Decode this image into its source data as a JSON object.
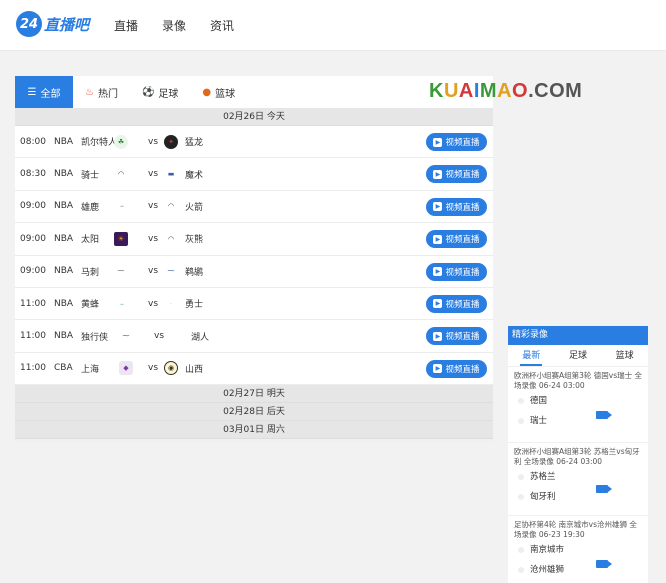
{
  "header": {
    "logo_number": "24",
    "logo_text": "直播吧",
    "nav": [
      "直播",
      "录像",
      "资讯"
    ]
  },
  "tabs": {
    "all": "全部",
    "hot": "热门",
    "football": "足球",
    "basketball": "篮球"
  },
  "brand_text": "KUAIMAO.COM",
  "dates": {
    "today": "02月26日 今天",
    "tomorrow": "02月27日 明天",
    "day_after": "02月28日 后天",
    "march1": "03月01日 周六"
  },
  "live_label": "视频直播",
  "vs_label": "vs",
  "matches": [
    {
      "time": "08:00",
      "league": "NBA",
      "home": "凯尔特人",
      "away": "猛龙"
    },
    {
      "time": "08:30",
      "league": "NBA",
      "home": "骑士",
      "away": "魔术"
    },
    {
      "time": "09:00",
      "league": "NBA",
      "home": "雄鹿",
      "away": "火箭"
    },
    {
      "time": "09:00",
      "league": "NBA",
      "home": "太阳",
      "away": "灰熊"
    },
    {
      "time": "09:00",
      "league": "NBA",
      "home": "马刺",
      "away": "鹈鹕"
    },
    {
      "time": "11:00",
      "league": "NBA",
      "home": "黄蜂",
      "away": "勇士"
    },
    {
      "time": "11:00",
      "league": "NBA",
      "home": "独行侠",
      "away": "湖人"
    },
    {
      "time": "11:00",
      "league": "CBA",
      "home": "上海",
      "away": "山西"
    }
  ],
  "sidebar": {
    "title": "精彩录像",
    "tabs": [
      "最新",
      "足球",
      "篮球"
    ],
    "items": [
      {
        "title": "欧洲杯小组赛A组第3轮 德国vs瑞士 全场录像 06-24 03:00",
        "team1": "德国",
        "team2": "瑞士"
      },
      {
        "title": "欧洲杯小组赛A组第3轮 苏格兰vs匈牙利 全场录像 06-24 03:00",
        "team1": "苏格兰",
        "team2": "匈牙利"
      },
      {
        "title": "足协杯第4轮 南京城市vs沧州雄狮 全场录像 06-23 19:30",
        "team1": "南京城市",
        "team2": "沧州雄狮"
      }
    ]
  },
  "colors": {
    "accent": "#2a7de1"
  }
}
